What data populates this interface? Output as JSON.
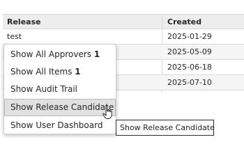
{
  "table": {
    "columns": [
      "Release",
      "Created"
    ],
    "rows": [
      {
        "release": "test",
        "created": "2025-01-29"
      },
      {
        "release": "",
        "created": "2025-05-09"
      },
      {
        "release": "",
        "created": "2025-06-18"
      },
      {
        "release": "",
        "created": "2025-07-10"
      }
    ]
  },
  "context_menu": {
    "items": [
      {
        "label": "Show All Approvers ",
        "count": "1"
      },
      {
        "label": "Show All Items ",
        "count": "1"
      },
      {
        "label": "Show Audit Trail",
        "count": ""
      },
      {
        "label": "Show Release Candidate",
        "count": "",
        "hovered": true
      },
      {
        "label": "Show User Dashboard",
        "count": ""
      }
    ]
  },
  "tooltip": {
    "text": "Show Release Candidate"
  },
  "cursor": {
    "type": "hand-pointer"
  }
}
